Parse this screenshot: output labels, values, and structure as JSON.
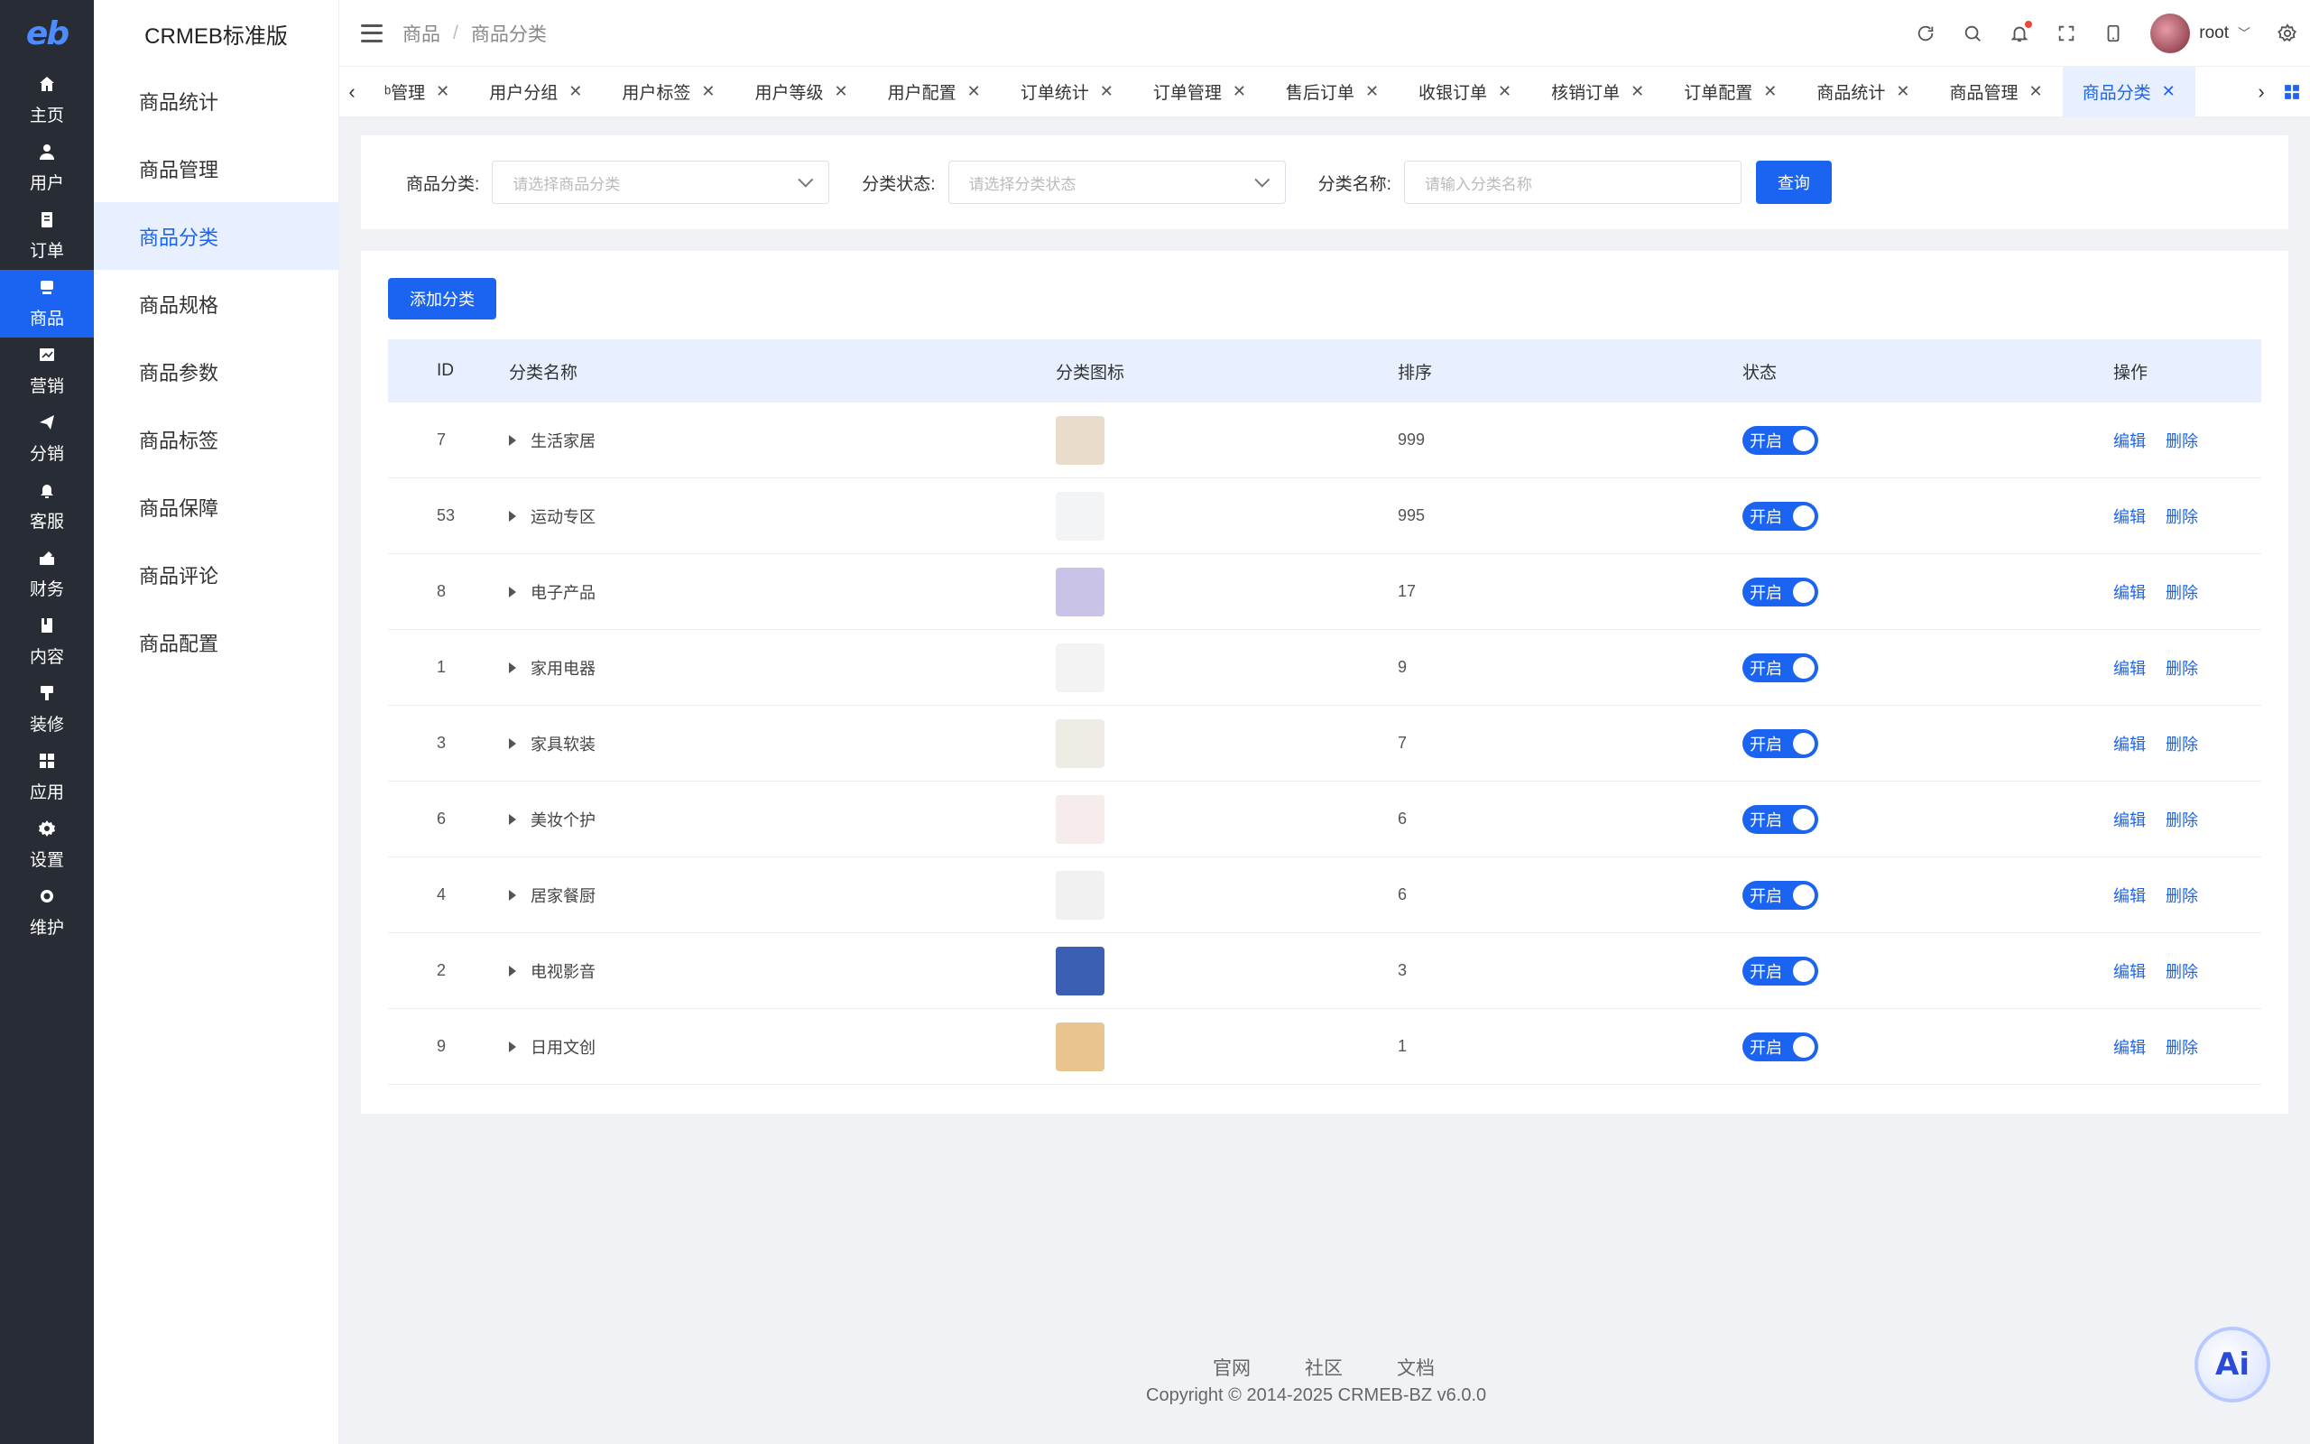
{
  "rail": {
    "logo": "eb",
    "items": [
      {
        "label": "主页",
        "icon": "home-icon"
      },
      {
        "label": "用户",
        "icon": "user-icon"
      },
      {
        "label": "订单",
        "icon": "order-icon"
      },
      {
        "label": "商品",
        "icon": "product-icon",
        "active": true
      },
      {
        "label": "营销",
        "icon": "marketing-icon"
      },
      {
        "label": "分销",
        "icon": "send-icon"
      },
      {
        "label": "客服",
        "icon": "bell-icon"
      },
      {
        "label": "财务",
        "icon": "finance-icon"
      },
      {
        "label": "内容",
        "icon": "content-icon"
      },
      {
        "label": "装修",
        "icon": "decorate-icon"
      },
      {
        "label": "应用",
        "icon": "apps-icon"
      },
      {
        "label": "设置",
        "icon": "gear-icon"
      },
      {
        "label": "维护",
        "icon": "maintain-icon"
      }
    ]
  },
  "subnav": {
    "title": "CRMEB标准版",
    "items": [
      "商品统计",
      "商品管理",
      "商品分类",
      "商品规格",
      "商品参数",
      "商品标签",
      "商品保障",
      "商品评论",
      "商品配置"
    ]
  },
  "header": {
    "crumb1": "商品",
    "sep": "/",
    "crumb2": "商品分类",
    "username": "root"
  },
  "tabs": {
    "items": [
      "ᵇ管理",
      "用户分组",
      "用户标签",
      "用户等级",
      "用户配置",
      "订单统计",
      "订单管理",
      "售后订单",
      "收银订单",
      "核销订单",
      "订单配置",
      "商品统计",
      "商品管理",
      "商品分类"
    ],
    "active_index": 13
  },
  "filter": {
    "category_label": "商品分类:",
    "category_placeholder": "请选择商品分类",
    "status_label": "分类状态:",
    "status_placeholder": "请选择分类状态",
    "name_label": "分类名称:",
    "name_placeholder": "请输入分类名称",
    "query_button": "查询"
  },
  "table": {
    "add_button": "添加分类",
    "headers": {
      "id": "ID",
      "name": "分类名称",
      "icon": "分类图标",
      "sort": "排序",
      "status": "状态",
      "ops": "操作"
    },
    "status_on": "开启",
    "edit": "编辑",
    "delete": "删除",
    "rows": [
      {
        "id": "7",
        "name": "生活家居",
        "sort": "999",
        "thumb": "#e9dccb"
      },
      {
        "id": "53",
        "name": "运动专区",
        "sort": "995",
        "thumb": "#f2f4f5"
      },
      {
        "id": "8",
        "name": "电子产品",
        "sort": "17",
        "thumb": "#c9c3e8"
      },
      {
        "id": "1",
        "name": "家用电器",
        "sort": "9",
        "thumb": "#f3f3f3"
      },
      {
        "id": "3",
        "name": "家具软装",
        "sort": "7",
        "thumb": "#eeeae4"
      },
      {
        "id": "6",
        "name": "美妆个护",
        "sort": "6",
        "thumb": "#f6ecec"
      },
      {
        "id": "4",
        "name": "居家餐厨",
        "sort": "6",
        "thumb": "#f1f1f1"
      },
      {
        "id": "2",
        "name": "电视影音",
        "sort": "3",
        "thumb": "#3b5fb3"
      },
      {
        "id": "9",
        "name": "日用文创",
        "sort": "1",
        "thumb": "#e9c48f"
      }
    ]
  },
  "footer": {
    "links": [
      "官网",
      "社区",
      "文档"
    ],
    "copyright": "Copyright © 2014-2025 CRMEB-BZ v6.0.0"
  },
  "ai_button": "Ai",
  "colors": {
    "primary": "#1b64f2",
    "rail": "#282c34",
    "highlight": "#e8f0ff"
  }
}
